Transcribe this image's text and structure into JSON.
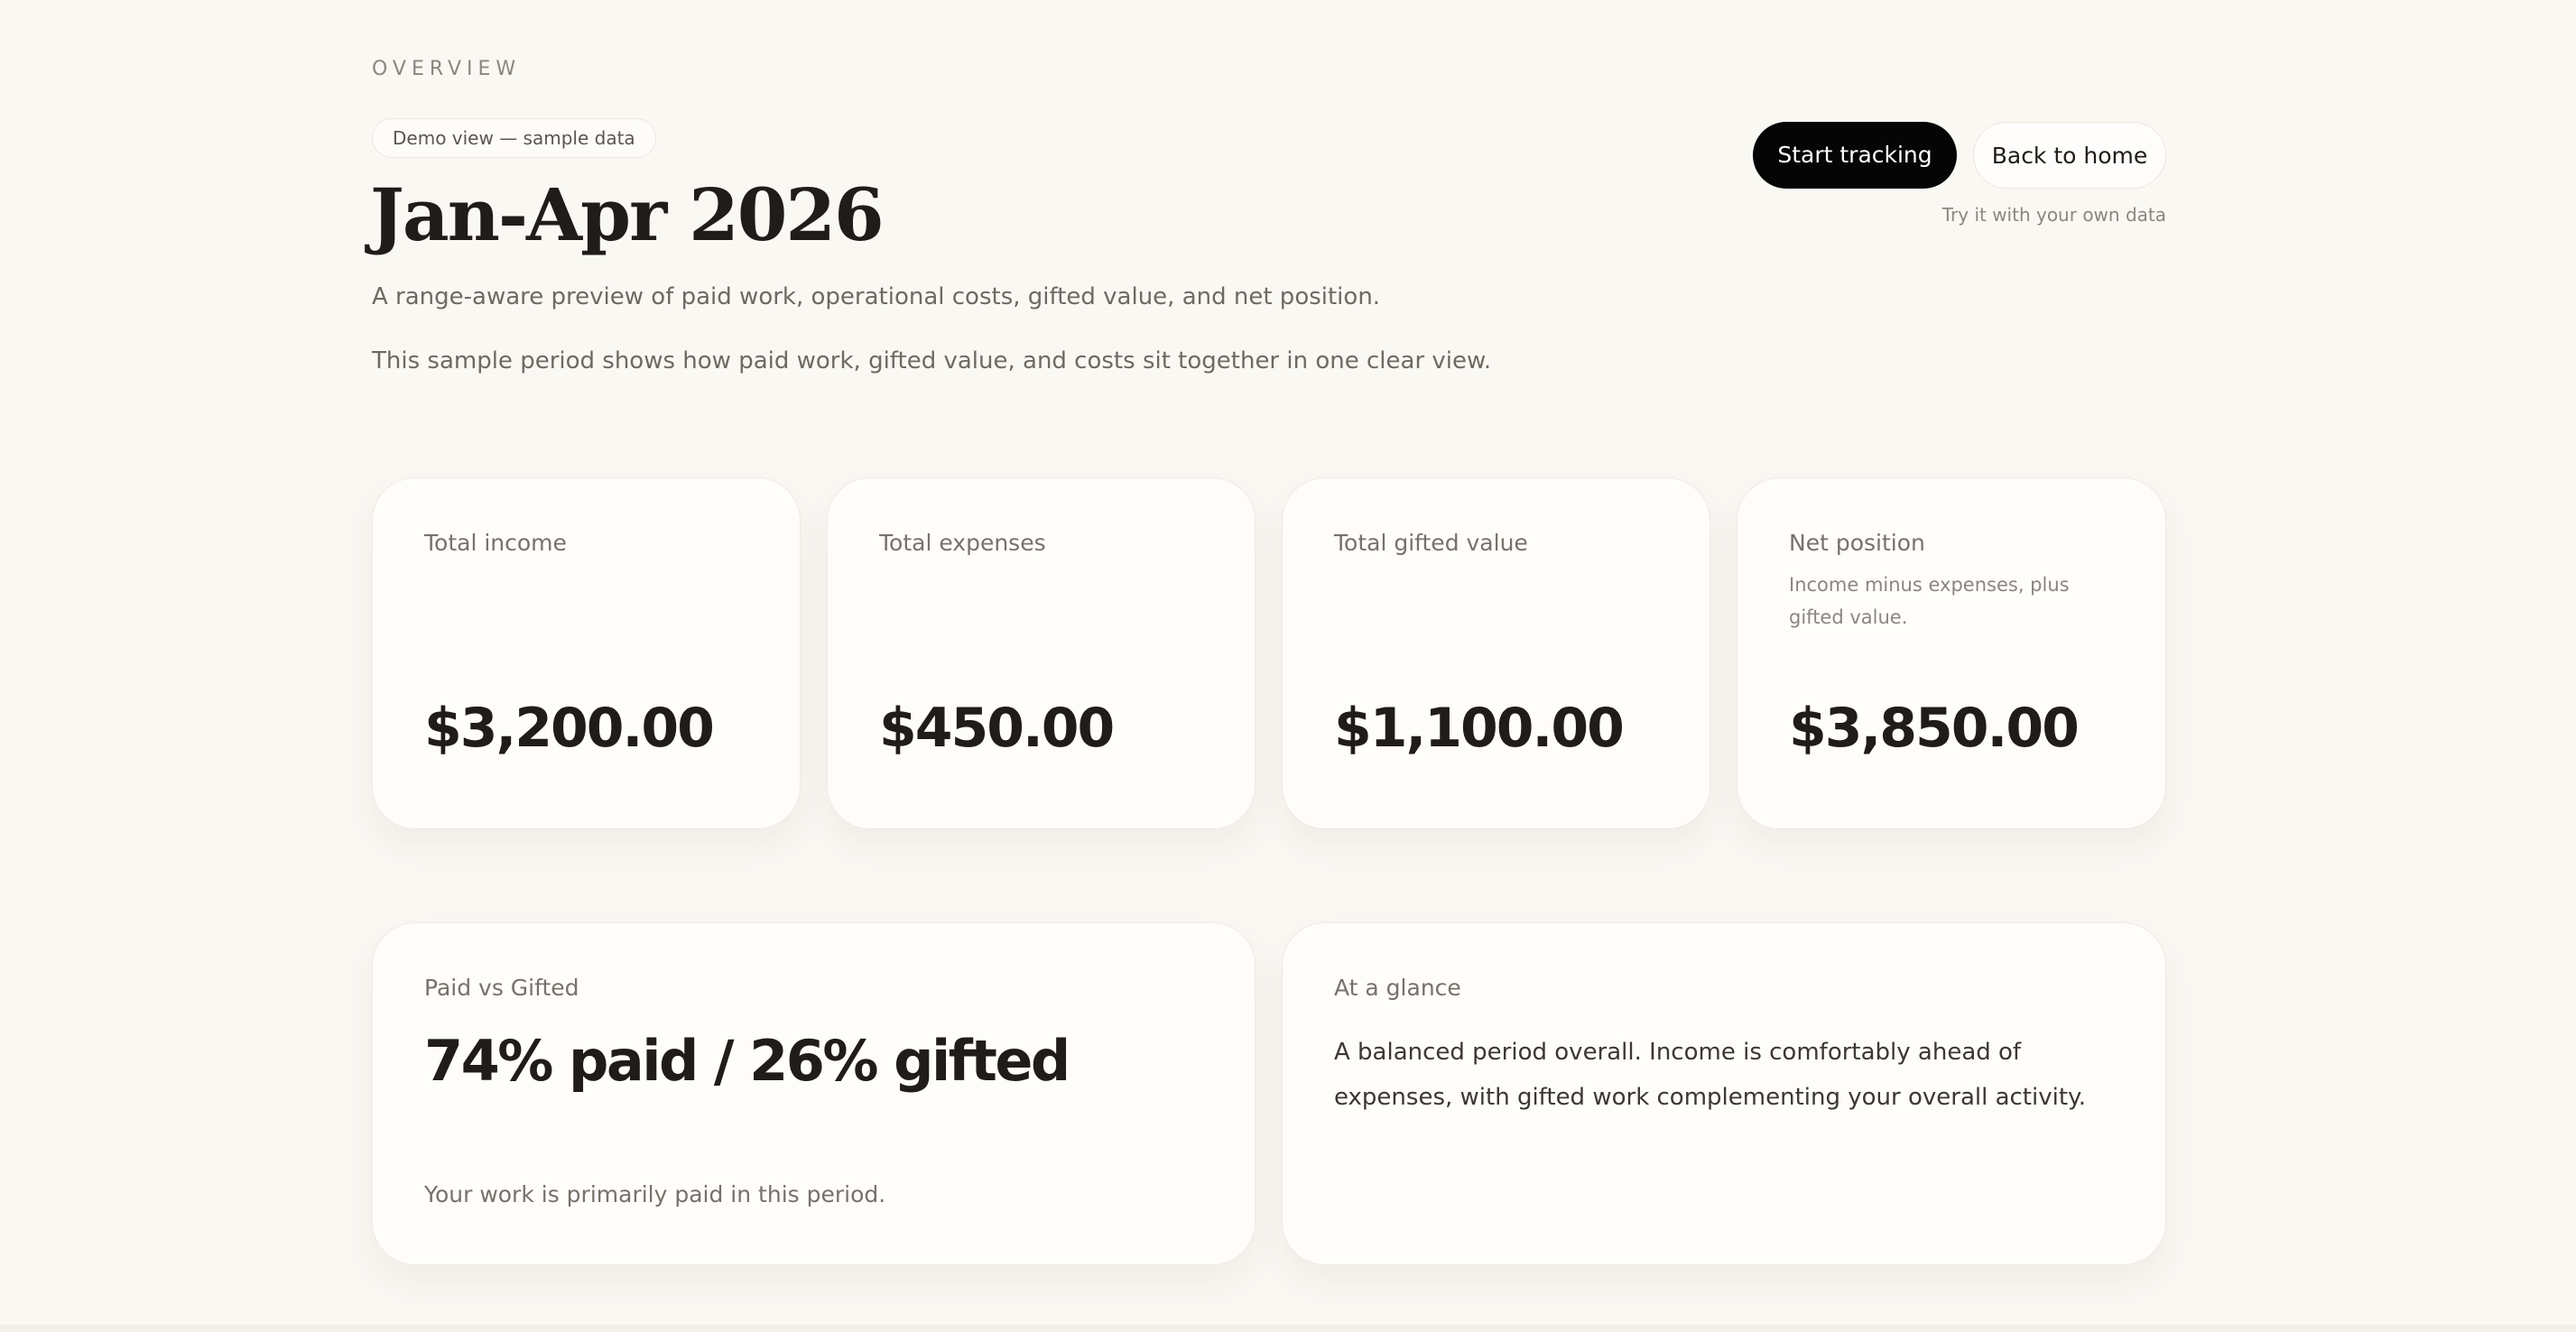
{
  "overview": {
    "eyebrow": "OVERVIEW",
    "demo_badge": "Demo view — sample data",
    "title": "Jan-Apr 2026",
    "subtitle": "A range-aware preview of paid work, operational costs, gifted value, and net position.",
    "description": "This sample period shows how paid work, gifted value, and costs sit together in one clear view."
  },
  "actions": {
    "primary_label": "Start tracking",
    "secondary_label": "Back to home",
    "hint": "Try it with your own data"
  },
  "metrics": [
    {
      "label": "Total income",
      "note": "",
      "value": "$3,200.00"
    },
    {
      "label": "Total expenses",
      "note": "",
      "value": "$450.00"
    },
    {
      "label": "Total gifted value",
      "note": "",
      "value": "$1,100.00"
    },
    {
      "label": "Net position",
      "note": "Income minus expenses, plus gifted value.",
      "value": "$3,850.00"
    }
  ],
  "split": {
    "label": "Paid vs Gifted",
    "value": "74% paid / 26% gifted",
    "paid_percent": 74,
    "gifted_percent": 26,
    "footnote": "Your work is primarily paid in this period."
  },
  "glance": {
    "label": "At a glance",
    "text": "A balanced period overall. Income is comfortably ahead of expenses, with gifted work complementing your overall activity."
  },
  "colors": {
    "background": "#faf8f3",
    "card": "#fefdfa",
    "primary_button": "#050505",
    "text": "#1f1c19",
    "muted": "#77716a"
  }
}
